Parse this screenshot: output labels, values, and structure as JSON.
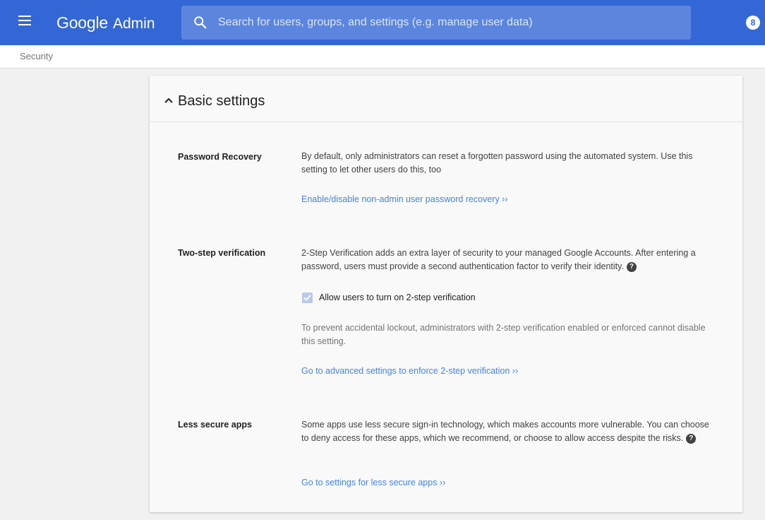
{
  "header": {
    "menu_icon": "menu-icon",
    "logo_google": "Google",
    "logo_admin": "Admin",
    "search_placeholder": "Search for users, groups, and settings (e.g. manage user data)",
    "search_value": "",
    "account_icon": "account-icon",
    "account_initial": "8",
    "brand_color": "#3367d6",
    "search_bg_color": "#5c85de"
  },
  "breadcrumb": {
    "label": "Security"
  },
  "card": {
    "title": "Basic settings",
    "expanded": true,
    "settings": [
      {
        "label": "Password Recovery",
        "description": "By default, only administrators can reset a forgotten password using the automated system. Use this setting to let other users do this, too",
        "link": "Enable/disable non-admin user password recovery ››"
      },
      {
        "label": "Two-step verification",
        "description": "2-Step Verification adds an extra layer of security to your managed Google Accounts. After entering a password, users must provide a second authentication factor to verify their identity.",
        "checkbox_label": "Allow users to turn on 2-step verification",
        "checkbox_checked": true,
        "checkbox_disabled": true,
        "note": "To prevent accidental lockout, administrators with 2-step verification enabled or enforced cannot disable this setting.",
        "link": "Go to advanced settings to enforce 2-step verification ››"
      },
      {
        "label": "Less secure apps",
        "description": "Some apps use less secure sign-in technology, which makes accounts more vulnerable. You can choose to deny access for these apps, which we recommend, or choose to allow access despite the risks.",
        "link": "Go to settings for less secure apps ››"
      }
    ],
    "link_color": "#4285f4"
  }
}
